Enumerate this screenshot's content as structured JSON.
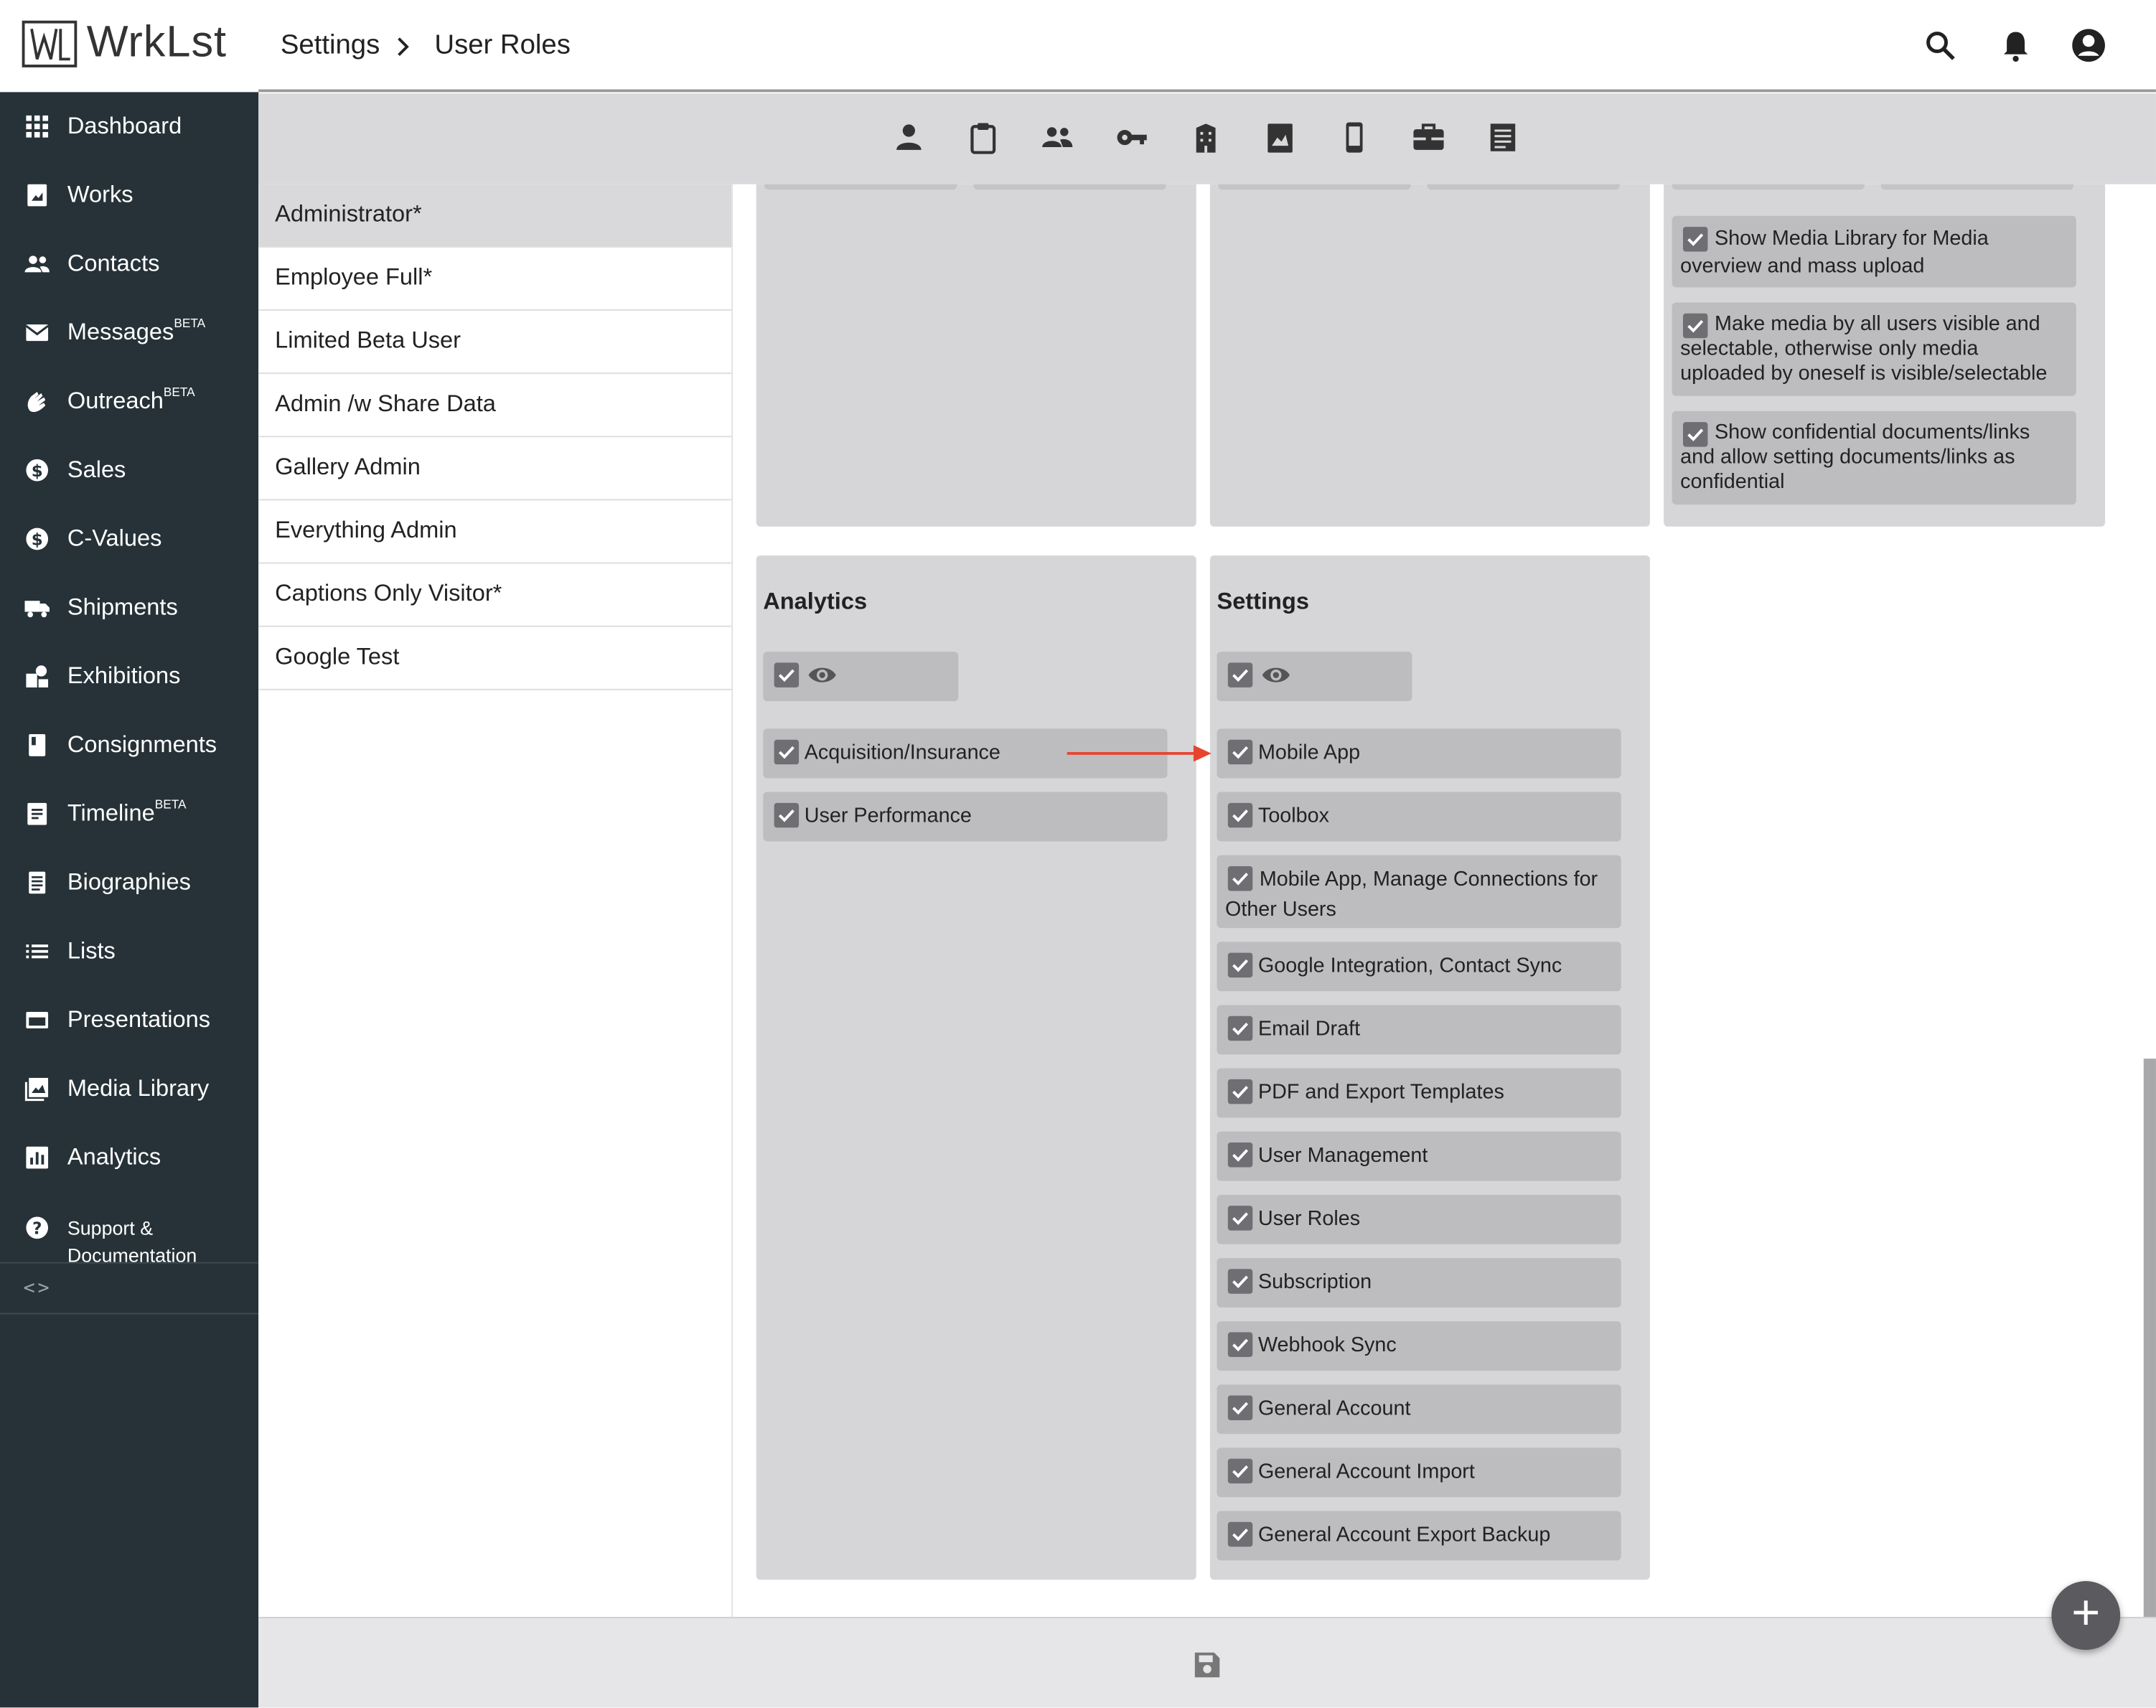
{
  "app": {
    "name": "WrkLst"
  },
  "header": {
    "breadcrumb_root": "Settings",
    "breadcrumb_current": "User Roles"
  },
  "top_icons": [
    "search-icon",
    "bell-icon",
    "account-icon"
  ],
  "sidebar": {
    "items": [
      {
        "label": "Dashboard",
        "badge": "",
        "icon": "grid-icon"
      },
      {
        "label": "Works",
        "badge": "",
        "icon": "works-icon"
      },
      {
        "label": "Contacts",
        "badge": "",
        "icon": "people-icon"
      },
      {
        "label": "Messages",
        "badge": "BETA",
        "icon": "mail-icon"
      },
      {
        "label": "Outreach",
        "badge": "BETA",
        "icon": "wave-icon"
      },
      {
        "label": "Sales",
        "badge": "",
        "icon": "dollar-icon"
      },
      {
        "label": "C-Values",
        "badge": "",
        "icon": "dollar-icon"
      },
      {
        "label": "Shipments",
        "badge": "",
        "icon": "truck-icon"
      },
      {
        "label": "Exhibitions",
        "badge": "",
        "icon": "shapes-icon"
      },
      {
        "label": "Consignments",
        "badge": "",
        "icon": "book-icon"
      },
      {
        "label": "Timeline",
        "badge": "BETA",
        "icon": "timeline-icon"
      },
      {
        "label": "Biographies",
        "badge": "",
        "icon": "biography-icon"
      },
      {
        "label": "Lists",
        "badge": "",
        "icon": "list-icon"
      },
      {
        "label": "Presentations",
        "badge": "",
        "icon": "presentation-icon"
      },
      {
        "label": "Media Library",
        "badge": "",
        "icon": "image-icon"
      },
      {
        "label": "Analytics",
        "badge": "",
        "icon": "chart-icon"
      }
    ],
    "support": {
      "line1": "Support &",
      "line2": "Documentation"
    },
    "collapse": "<>"
  },
  "toolbar_icons": [
    "person-icon",
    "clipboard-icon",
    "group-icon",
    "key-icon",
    "building-icon",
    "portrait-icon",
    "phone-icon",
    "toolbox-icon",
    "receipt-icon"
  ],
  "roles": [
    "Administrator*",
    "Employee Full*",
    "Limited Beta User",
    "Admin /w Share Data",
    "Gallery Admin",
    "Everything Admin",
    "Captions Only Visitor*",
    "Google Test"
  ],
  "active_role": "Administrator*",
  "media_permissions": [
    "Show Media Library for Media overview and mass upload",
    "Make media by all users visible and selectable, otherwise only media uploaded by oneself is visible/selectable",
    "Show confidential documents/links and allow setting documents/links as confidential"
  ],
  "analytics": {
    "title": "Analytics",
    "items": [
      "Acquisition/Insurance",
      "User Performance"
    ]
  },
  "settings": {
    "title": "Settings",
    "items": [
      "Mobile App",
      "Toolbox",
      "Mobile App, Manage Connections for Other Users",
      "Google Integration, Contact Sync",
      "Email Draft",
      "PDF and Export Templates",
      "User Management",
      "User Roles",
      "Subscription",
      "Webhook Sync",
      "General Account",
      "General Account Import",
      "General Account Export Backup"
    ]
  },
  "colors": {
    "sidebar": "#263238",
    "panel": "#d6d6d9",
    "chip": "#bdbdc0",
    "arrow": "#e8432e"
  },
  "footer": {
    "save_icon": "save-icon",
    "add_icon": "plus-icon"
  }
}
